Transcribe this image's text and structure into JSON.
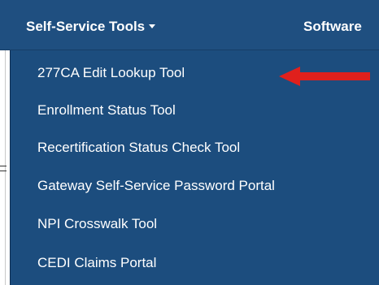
{
  "nav": {
    "items": [
      {
        "label": "Self-Service Tools"
      },
      {
        "label": "Software"
      }
    ]
  },
  "dropdown": {
    "items": [
      {
        "label": "277CA Edit Lookup Tool"
      },
      {
        "label": "Enrollment Status Tool"
      },
      {
        "label": "Recertification Status Check Tool"
      },
      {
        "label": "Gateway Self-Service Password Portal"
      },
      {
        "label": "NPI Crosswalk Tool"
      },
      {
        "label": "CEDI Claims Portal"
      }
    ]
  },
  "colors": {
    "nav_background": "#1f4f80",
    "menu_background": "#1c4d7e",
    "text": "#ffffff",
    "annotation_arrow": "#e0201c"
  },
  "icons": {
    "dropdown_caret": "caret-down-icon",
    "annotation": "red-arrow-icon"
  }
}
